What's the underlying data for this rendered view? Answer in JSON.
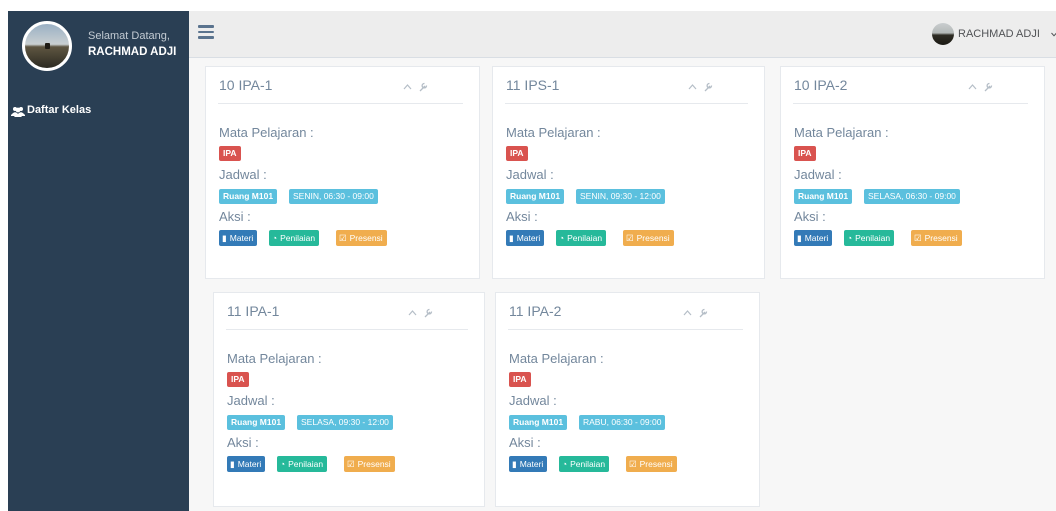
{
  "colors": {
    "sidebar": "#2a3f54",
    "danger": "#d9534f",
    "info": "#5bc0de",
    "primary": "#337ab7",
    "success": "#26b99a",
    "warning": "#f0ad4e"
  },
  "sidebar": {
    "greeting": "Selamat Datang,",
    "user_name": "RACHMAD ADJI",
    "menu": [
      {
        "label": "Daftar Kelas",
        "icon": "users-icon"
      }
    ]
  },
  "topbar": {
    "user_name": "RACHMAD ADJI"
  },
  "cards": [
    {
      "title": "10 IPA-1",
      "subject_label": "Mata Pelajaran :",
      "subject": "IPA",
      "schedule_label": "Jadwal :",
      "room": "Ruang M101",
      "time": "SENIN, 06:30 - 09:00",
      "action_label": "Aksi :",
      "actions": [
        "Materi",
        "Penilaian",
        "Presensi"
      ]
    },
    {
      "title": "11 IPS-1",
      "subject_label": "Mata Pelajaran :",
      "subject": "IPA",
      "schedule_label": "Jadwal :",
      "room": "Ruang M101",
      "time": "SENIN, 09:30 - 12:00",
      "action_label": "Aksi :",
      "actions": [
        "Materi",
        "Penilaian",
        "Presensi"
      ]
    },
    {
      "title": "10 IPA-2",
      "subject_label": "Mata Pelajaran :",
      "subject": "IPA",
      "schedule_label": "Jadwal :",
      "room": "Ruang M101",
      "time": "SELASA, 06:30 - 09:00",
      "action_label": "Aksi :",
      "actions": [
        "Materi",
        "Penilaian",
        "Presensi"
      ]
    },
    {
      "title": "11 IPA-1",
      "subject_label": "Mata Pelajaran :",
      "subject": "IPA",
      "schedule_label": "Jadwal :",
      "room": "Ruang M101",
      "time": "SELASA, 09:30 - 12:00",
      "action_label": "Aksi :",
      "actions": [
        "Materi",
        "Penilaian",
        "Presensi"
      ]
    },
    {
      "title": "11 IPA-2",
      "subject_label": "Mata Pelajaran :",
      "subject": "IPA",
      "schedule_label": "Jadwal :",
      "room": "Ruang M101",
      "time": "RABU, 06:30 - 09:00",
      "action_label": "Aksi :",
      "actions": [
        "Materi",
        "Penilaian",
        "Presensi"
      ]
    }
  ]
}
